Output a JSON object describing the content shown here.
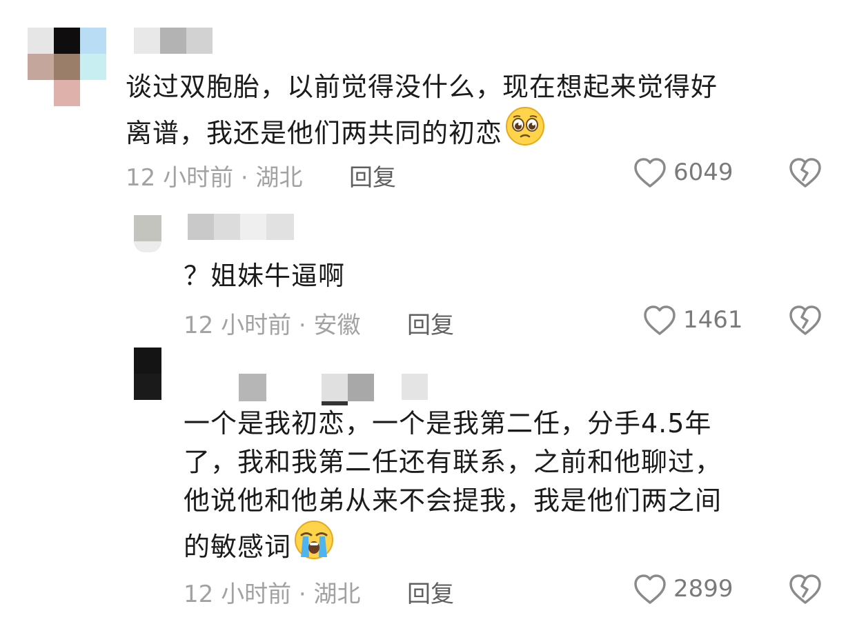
{
  "colors": {
    "text": "#1b1b1b",
    "meta": "#a2a2a2",
    "reply": "#5f5f5f",
    "icon": "#8a8a8a",
    "background": "#ffffff"
  },
  "comments": [
    {
      "lines": [
        "谈过双胞胎，以前觉得没什么，现在想起来觉得好",
        "离谱，我还是他们两共同的初恋"
      ],
      "emoji": "pleading-face-emoji",
      "time": "12 小时前",
      "location": "湖北",
      "reply_label": "回复",
      "like_count": "6049"
    },
    {
      "lines": [
        "？姐妹牛逼啊"
      ],
      "time": "12 小时前",
      "location": "安徽",
      "reply_label": "回复",
      "like_count": "1461"
    },
    {
      "lines": [
        "一个是我初恋，一个是我第二任，分手4.5年",
        "了，我和我第二任还有联系，之前和他聊过，",
        "他说他和他弟从来不会提我，我是他们两之间",
        "的敏感词"
      ],
      "emoji": "loudly-crying-face-emoji",
      "time": "12 小时前",
      "location": "湖北",
      "reply_label": "回复",
      "like_count": "2899"
    }
  ],
  "separator": "·"
}
